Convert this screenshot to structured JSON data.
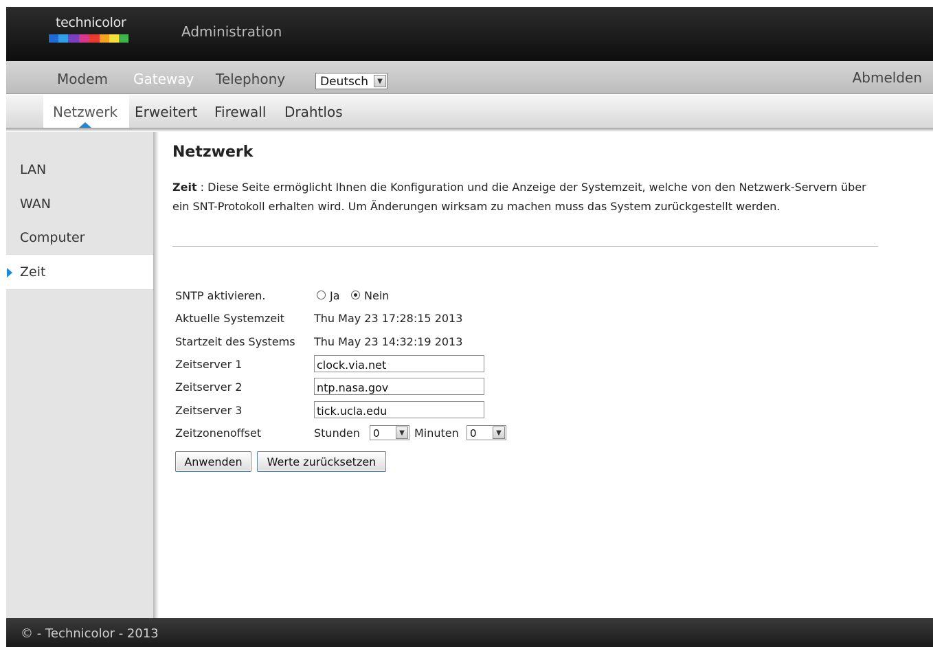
{
  "header": {
    "logo_text": "technicolor",
    "title": "Administration"
  },
  "mainnav": {
    "items": [
      {
        "label": "Modem"
      },
      {
        "label": "Gateway"
      },
      {
        "label": "Telephony"
      }
    ],
    "language_selected": "Deutsch",
    "logout": "Abmelden"
  },
  "subnav": {
    "items": [
      {
        "label": "Netzwerk"
      },
      {
        "label": "Erweitert"
      },
      {
        "label": "Firewall"
      },
      {
        "label": "Drahtlos"
      }
    ]
  },
  "sidebar": {
    "items": [
      {
        "label": "LAN"
      },
      {
        "label": "WAN"
      },
      {
        "label": "Computer"
      },
      {
        "label": "Zeit"
      }
    ]
  },
  "main": {
    "title": "Netzwerk",
    "desc_bold": "Zeit",
    "desc_text": " : Diese Seite ermöglicht Ihnen die Konfiguration und die Anzeige der Systemzeit, welche von den Netzwerk-Servern über ein SNT-Protokoll erhalten wird. Um Änderungen wirksam zu machen muss das System zurückgestellt werden.",
    "form": {
      "sntp_label": "SNTP aktivieren.",
      "sntp_yes": "Ja",
      "sntp_no": "Nein",
      "sntp_value": "Nein",
      "current_time_label": "Aktuelle Systemzeit",
      "current_time": "Thu May 23 17:28:15 2013",
      "start_time_label": "Startzeit des Systems",
      "start_time": "Thu May 23 14:32:19 2013",
      "server1_label": "Zeitserver 1",
      "server1": "clock.via.net",
      "server2_label": "Zeitserver 2",
      "server2": "ntp.nasa.gov",
      "server3_label": "Zeitserver 3",
      "server3": "tick.ucla.edu",
      "offset_label": "Zeitzonenoffset",
      "hours_label": "Stunden",
      "hours_value": "0",
      "minutes_label": "Minuten",
      "minutes_value": "0",
      "apply_button": "Anwenden",
      "reset_button": "Werte zurücksetzen"
    }
  },
  "footer": {
    "text": "© - Technicolor - 2013"
  },
  "colors": {
    "accent": "#1e88d6",
    "topbar": "#1a1a1a"
  }
}
